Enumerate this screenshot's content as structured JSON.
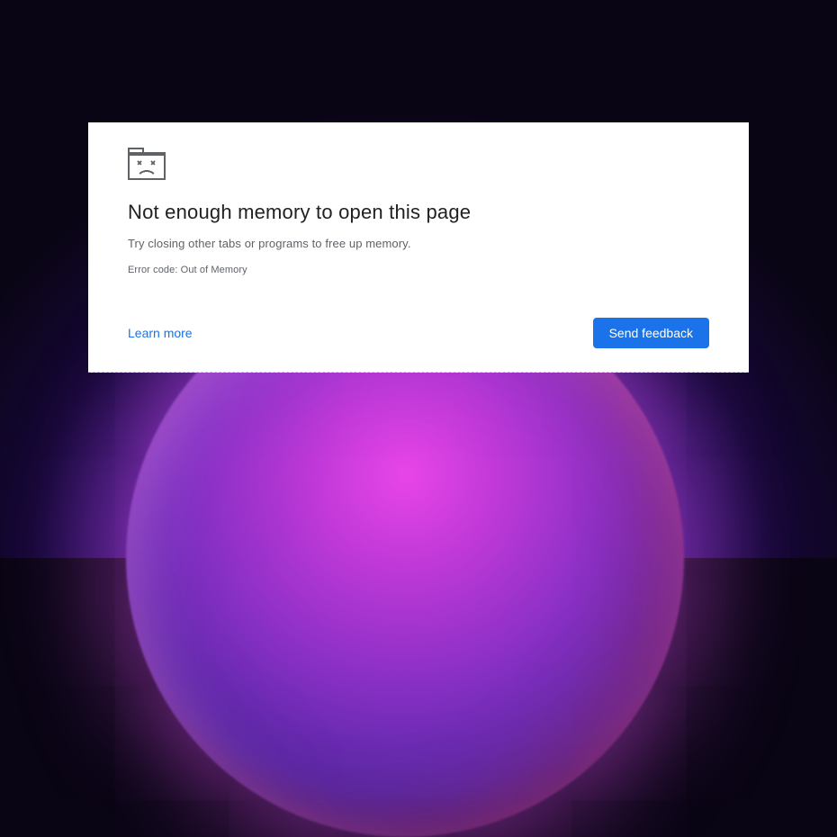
{
  "error": {
    "title": "Not enough memory to open this page",
    "subtitle": "Try closing other tabs or programs to free up memory.",
    "code": "Error code: Out of Memory",
    "learn_more_label": "Learn more",
    "send_feedback_label": "Send feedback"
  },
  "colors": {
    "primary": "#1a73e8",
    "text": "#202124",
    "muted": "#5f6368"
  }
}
